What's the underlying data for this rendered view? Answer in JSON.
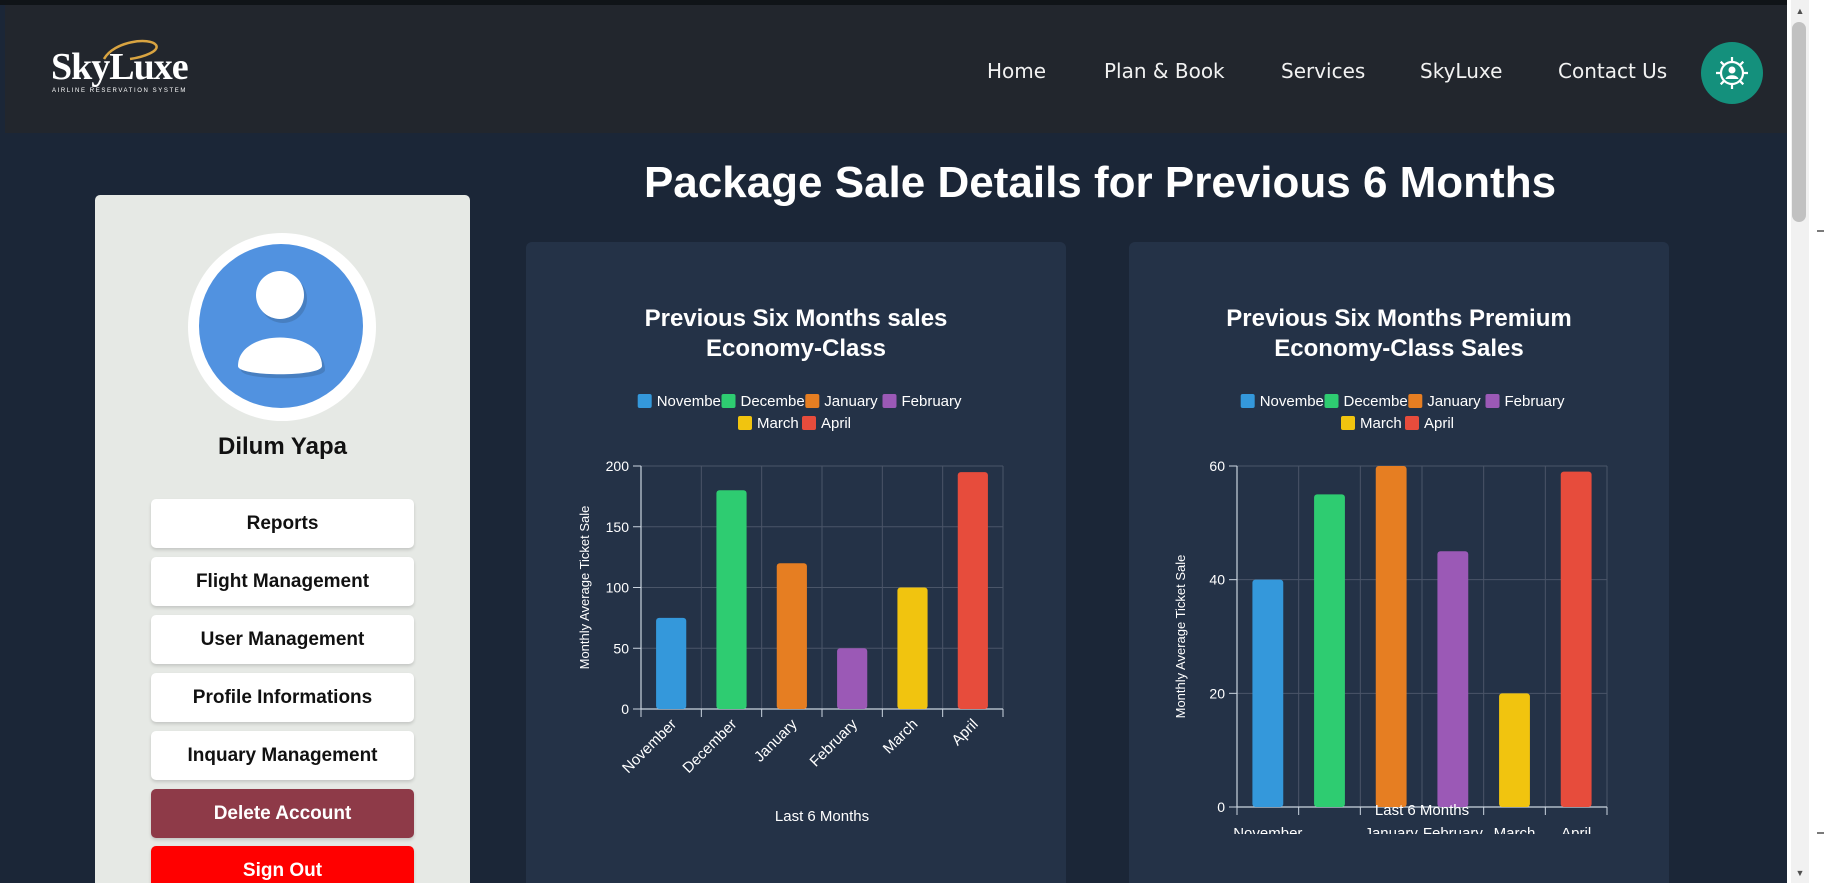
{
  "brand": {
    "name": "SkyLuxe",
    "tagline": "AIRLINE RESERVATION SYSTEM"
  },
  "nav": {
    "items": [
      "Home",
      "Plan & Book",
      "Services",
      "SkyLuxe",
      "Contact Us"
    ],
    "settings_icon": "user-gear-icon"
  },
  "sidebar": {
    "avatar_icon": "user-avatar-icon",
    "user_name": "Dilum Yapa",
    "buttons": [
      "Reports",
      "Flight Management",
      "User Management",
      "Profile Informations",
      "Inquary Management",
      "Delete Account",
      "Sign Out"
    ]
  },
  "page": {
    "title": "Package Sale Details for Previous 6 Months"
  },
  "colors": {
    "November": "#3498db",
    "December": "#2ecc71",
    "January": "#e67e22",
    "February": "#9b59b6",
    "March": "#f1c40f",
    "April": "#e74c3c",
    "delete": "#8e3a48",
    "signout": "#ff0000",
    "settings": "#14907c"
  },
  "chart_data": [
    {
      "type": "bar",
      "title_lines": [
        "Previous Six Months sales",
        "Economy-Class"
      ],
      "categories": [
        "November",
        "December",
        "January",
        "February",
        "March",
        "April"
      ],
      "values": [
        75,
        180,
        120,
        50,
        100,
        195
      ],
      "xlabel": "Last 6 Months",
      "ylabel": "Monthly Average Ticket Sale",
      "ylim": [
        0,
        200
      ],
      "yticks": [
        0,
        50,
        100,
        150,
        200
      ],
      "grid": true,
      "legend": "top",
      "rotated_xlabels": true
    },
    {
      "type": "bar",
      "title_lines": [
        "Previous Six Months Premium",
        "Economy-Class Sales"
      ],
      "categories": [
        "November",
        "December",
        "January",
        "February",
        "March",
        "April"
      ],
      "values": [
        40,
        55,
        60,
        45,
        20,
        59
      ],
      "xlabel": "Last 6 Months",
      "ylabel": "Monthly Average Ticket Sale",
      "ylim": [
        0,
        60
      ],
      "yticks": [
        0,
        20,
        40,
        60
      ],
      "grid": true,
      "legend": "top",
      "rotated_xlabels": false,
      "shown_xtick_labels": [
        "November",
        "",
        "January",
        "February",
        "March",
        "April"
      ]
    }
  ]
}
